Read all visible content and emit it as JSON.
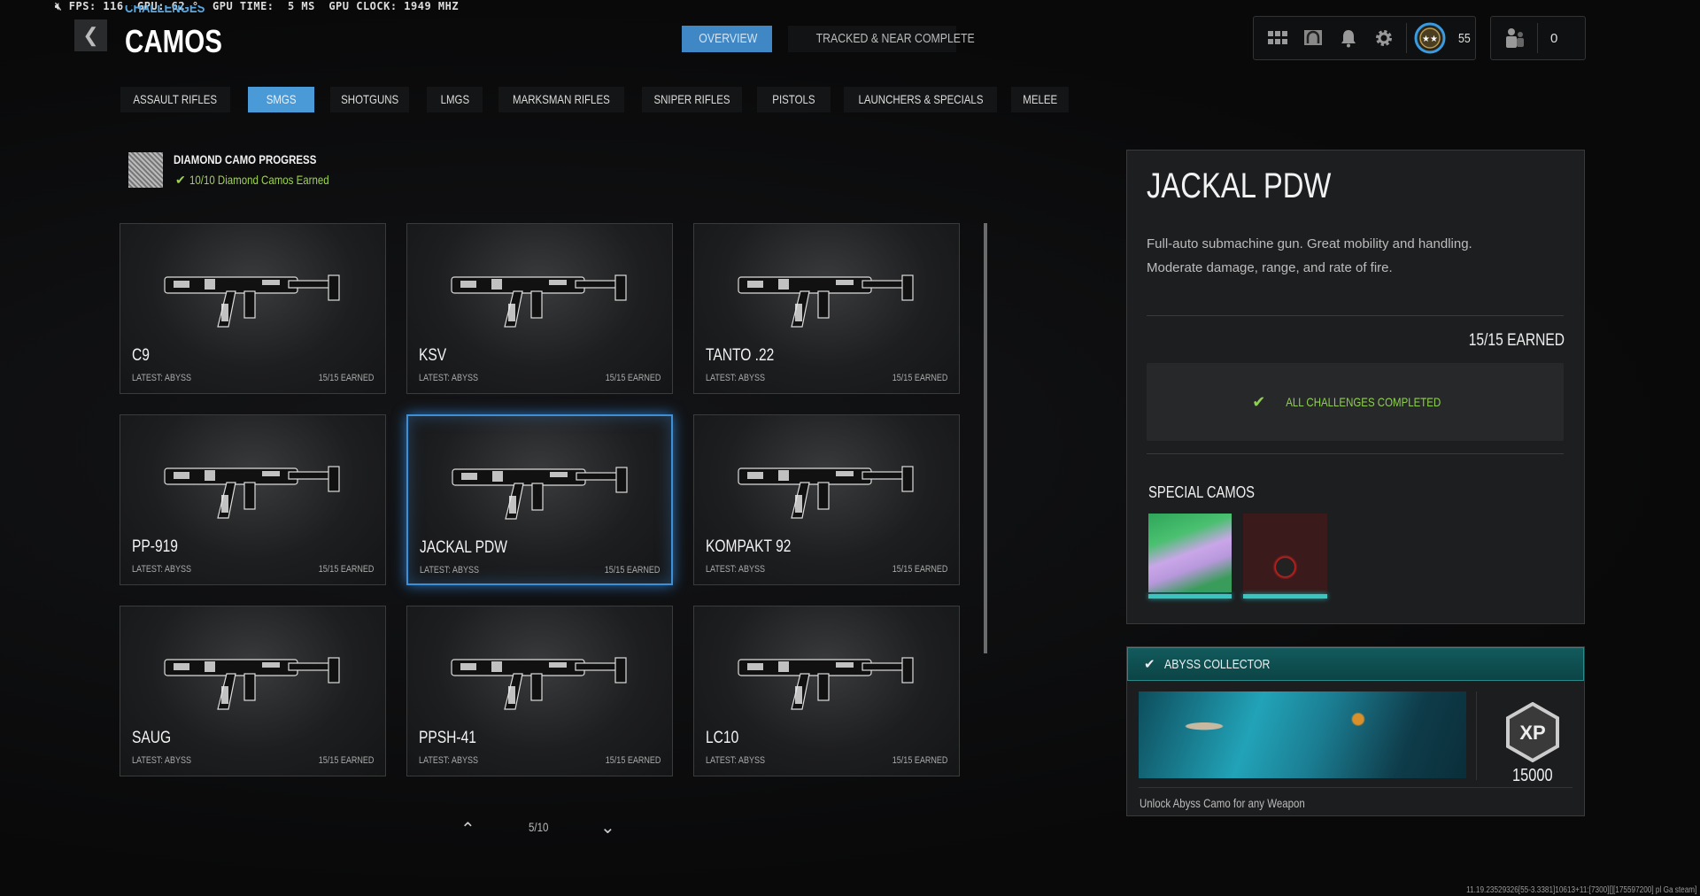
{
  "perf_overlay": "FPS: 116  GPU: 62 °  GPU TIME:  5 MS  GPU CLOCK: 1949 MHZ",
  "header": {
    "breadcrumb": "CHALLENGES",
    "title": "CAMOS",
    "back_label": "❮"
  },
  "top_tabs": [
    {
      "label": "OVERVIEW",
      "active": true
    },
    {
      "label": "TRACKED & NEAR COMPLETE",
      "active": false
    }
  ],
  "hud": {
    "level": "55",
    "party_count": "0",
    "icons": [
      "grid-icon",
      "headset-icon",
      "bell-icon",
      "gear-icon",
      "rank-emblem-icon",
      "party-icon"
    ]
  },
  "categories": [
    {
      "label": "ASSAULT RIFLES"
    },
    {
      "label": "SMGS",
      "active": true
    },
    {
      "label": "SHOTGUNS"
    },
    {
      "label": "LMGS"
    },
    {
      "label": "MARKSMAN RIFLES"
    },
    {
      "label": "SNIPER RIFLES"
    },
    {
      "label": "PISTOLS"
    },
    {
      "label": "LAUNCHERS & SPECIALS"
    },
    {
      "label": "MELEE"
    }
  ],
  "diamond": {
    "title": "DIAMOND CAMO PROGRESS",
    "status": "10/10 Diamond Camos Earned"
  },
  "weapons": [
    {
      "name": "C9",
      "latest": "LATEST: ABYSS",
      "earned": "15/15 EARNED"
    },
    {
      "name": "KSV",
      "latest": "LATEST: ABYSS",
      "earned": "15/15 EARNED"
    },
    {
      "name": "TANTO .22",
      "latest": "LATEST: ABYSS",
      "earned": "15/15 EARNED"
    },
    {
      "name": "PP-919",
      "latest": "LATEST: ABYSS",
      "earned": "15/15 EARNED"
    },
    {
      "name": "JACKAL PDW",
      "latest": "LATEST: ABYSS",
      "earned": "15/15 EARNED",
      "selected": true
    },
    {
      "name": "KOMPAKT 92",
      "latest": "LATEST: ABYSS",
      "earned": "15/15 EARNED"
    },
    {
      "name": "SAUG",
      "latest": "LATEST: ABYSS",
      "earned": "15/15 EARNED"
    },
    {
      "name": "PPSH-41",
      "latest": "LATEST: ABYSS",
      "earned": "15/15 EARNED"
    },
    {
      "name": "LC10",
      "latest": "LATEST: ABYSS",
      "earned": "15/15 EARNED"
    }
  ],
  "pagination": {
    "page": "5/10"
  },
  "detail": {
    "title": "JACKAL PDW",
    "desc1": "Full-auto submachine gun.  Great mobility and handling.",
    "desc2": "Moderate damage, range, and rate of fire.",
    "earned": "15/15 EARNED",
    "status": "ALL CHALLENGES COMPLETED",
    "special_label": "SPECIAL CAMOS"
  },
  "reward": {
    "title": "ABYSS COLLECTOR",
    "xp_label": "XP",
    "xp": "15000",
    "desc": "Unlock Abyss Camo for any Weapon"
  },
  "build_info": "11.19.23529326[55-3.3381]10613+11:[7300][][175597200] pl Ga steam]",
  "colors": {
    "accent": "#4a9ad8",
    "success": "#8fd14f",
    "teal": "#0f4a4c"
  }
}
